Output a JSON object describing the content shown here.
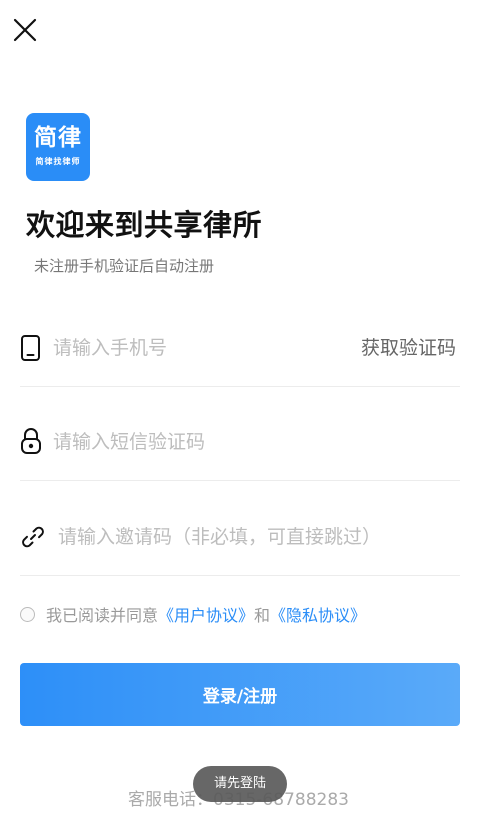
{
  "logo": {
    "main_text": "简律",
    "sub_text": "简律找律师",
    "color": "#2a8df7"
  },
  "header": {
    "title": "欢迎来到共享律所",
    "subtitle": "未注册手机验证后自动注册"
  },
  "form": {
    "phone": {
      "placeholder": "请输入手机号",
      "icon": "phone-icon"
    },
    "get_code_label": "获取验证码",
    "sms_code": {
      "placeholder": "请输入短信验证码",
      "icon": "lock-icon"
    },
    "invite_code": {
      "placeholder": "请输入邀请码（非必填，可直接跳过）",
      "icon": "link-icon"
    }
  },
  "agreement": {
    "prefix": "我已阅读并同意",
    "user_agreement": "《用户协议》",
    "conjunction": "和",
    "privacy_policy": "《隐私协议》",
    "checked": false
  },
  "login_button": {
    "label": "登录/注册"
  },
  "service_phone": "客服电话：0315-68788283",
  "toast": {
    "message": "请先登陆"
  },
  "colors": {
    "accent": "#2a8df7",
    "button_gradient_end": "#5aaaf9"
  }
}
